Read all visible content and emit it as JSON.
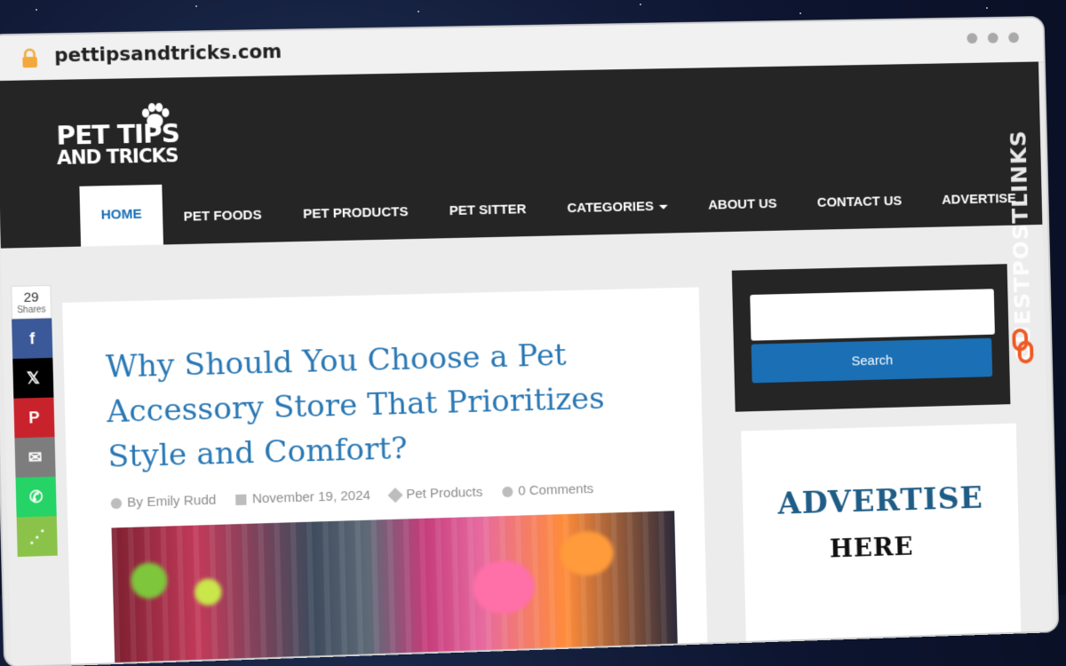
{
  "browser": {
    "url": "pettipsandtricks.com"
  },
  "site": {
    "logo": {
      "line1": "PET TIPS",
      "line2": "AND TRICKS"
    },
    "nav": [
      {
        "label": "HOME",
        "active": true
      },
      {
        "label": "PET FOODS"
      },
      {
        "label": "PET PRODUCTS"
      },
      {
        "label": "PET SITTER"
      },
      {
        "label": "CATEGORIES",
        "dropdown": true
      },
      {
        "label": "ABOUT US"
      },
      {
        "label": "CONTACT US"
      },
      {
        "label": "ADVERTISE"
      }
    ]
  },
  "share": {
    "count": "29",
    "label": "Shares",
    "buttons": [
      {
        "icon": "facebook-icon",
        "glyph": "f",
        "color": "#3b5998"
      },
      {
        "icon": "x-icon",
        "glyph": "𝕏",
        "color": "#000000"
      },
      {
        "icon": "pinterest-icon",
        "glyph": "P",
        "color": "#c8232c"
      },
      {
        "icon": "email-icon",
        "glyph": "✉",
        "color": "#7d7d7d"
      },
      {
        "icon": "whatsapp-icon",
        "glyph": "✆",
        "color": "#25d366"
      },
      {
        "icon": "share-icon",
        "glyph": "⋰",
        "color": "#8bc34a"
      }
    ]
  },
  "article": {
    "title": "Why Should You Choose a Pet Accessory Store That Prioritizes Style and Comfort?",
    "meta": {
      "author": "By Emily Rudd",
      "date": "November 19, 2024",
      "category": "Pet Products",
      "comments": "0 Comments"
    }
  },
  "sidebar": {
    "search_input": "",
    "search_button": "Search",
    "ad_line1": "ADVERTISE",
    "ad_line2": "HERE"
  },
  "watermark": {
    "text_main": "GUESTPOSTLINKS",
    "icon": "chain-link-icon"
  },
  "colors": {
    "accent": "#1a6fb5",
    "header": "#252525",
    "watermark_accent": "#ef5a24"
  }
}
